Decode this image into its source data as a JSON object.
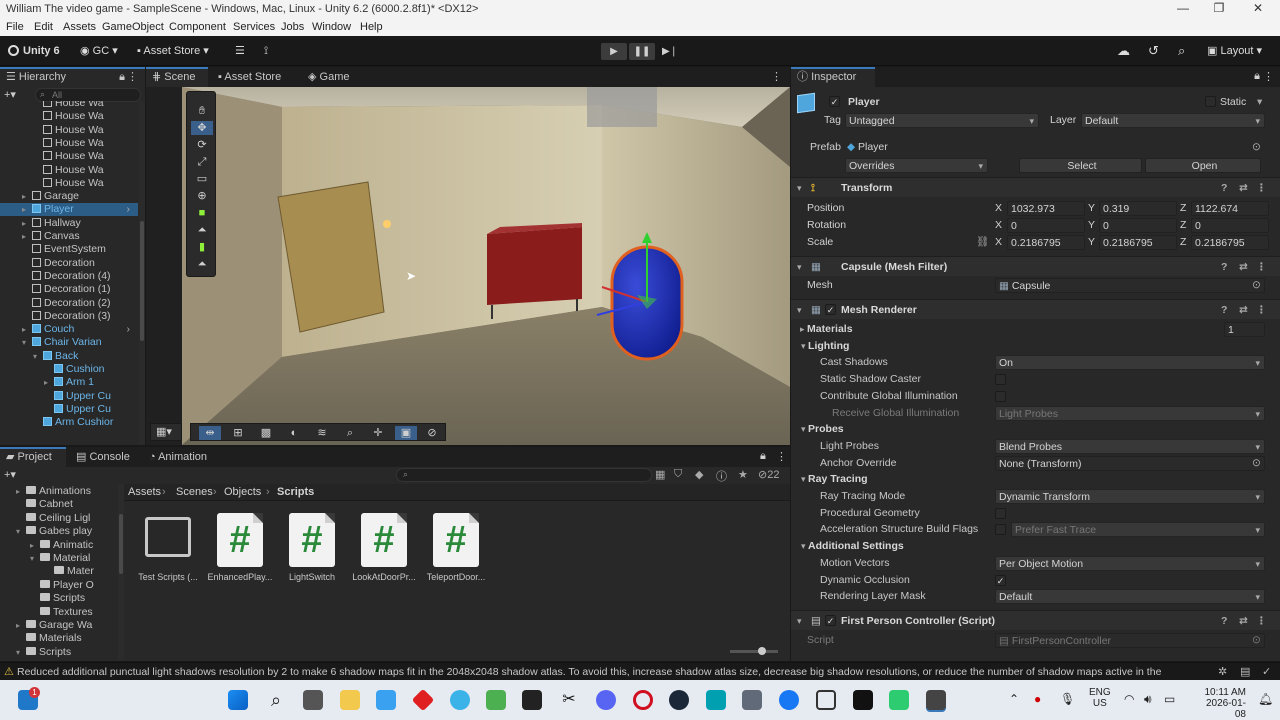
{
  "window": {
    "title": "William The video game - SampleScene - Windows, Mac, Linux - Unity 6.2 (6000.2.8f1)* <DX12>",
    "minimize": "—",
    "maximize": "❐",
    "close": "✕"
  },
  "menu": [
    "File",
    "Edit",
    "Assets",
    "GameObject",
    "Component",
    "Services",
    "Jobs",
    "Window",
    "Help"
  ],
  "toolbar": {
    "unity_label": "Unity 6",
    "gc_label": "GC",
    "asset_store_label": "Asset Store",
    "layout_label": "Layout"
  },
  "hierarchy": {
    "tab_label": "Hierarchy",
    "search_placeholder": "All",
    "items": [
      {
        "label": "House Wa",
        "indent": 3,
        "icon": "white",
        "selected": false,
        "arrow": ""
      },
      {
        "label": "House Wa",
        "indent": 3,
        "icon": "white",
        "selected": false,
        "arrow": ""
      },
      {
        "label": "House Wa",
        "indent": 3,
        "icon": "white",
        "selected": false,
        "arrow": ""
      },
      {
        "label": "House Wa",
        "indent": 3,
        "icon": "white",
        "selected": false,
        "arrow": ""
      },
      {
        "label": "House Wa",
        "indent": 3,
        "icon": "white",
        "selected": false,
        "arrow": ""
      },
      {
        "label": "House Wa",
        "indent": 3,
        "icon": "white",
        "selected": false,
        "arrow": ""
      },
      {
        "label": "House Wa",
        "indent": 3,
        "icon": "white",
        "selected": false,
        "arrow": ""
      },
      {
        "label": "Garage",
        "indent": 2,
        "icon": "white",
        "selected": false,
        "arrow": "▸"
      },
      {
        "label": "Player",
        "indent": 2,
        "icon": "blue",
        "selected": true,
        "arrow": "▸"
      },
      {
        "label": "Hallway",
        "indent": 2,
        "icon": "white",
        "selected": false,
        "arrow": "▸"
      },
      {
        "label": "Canvas",
        "indent": 2,
        "icon": "white",
        "selected": false,
        "arrow": "▸"
      },
      {
        "label": "EventSystem",
        "indent": 2,
        "icon": "white",
        "selected": false,
        "arrow": ""
      },
      {
        "label": "Decoration",
        "indent": 2,
        "icon": "white",
        "selected": false,
        "arrow": ""
      },
      {
        "label": "Decoration (4)",
        "indent": 2,
        "icon": "white",
        "selected": false,
        "arrow": ""
      },
      {
        "label": "Decoration (1)",
        "indent": 2,
        "icon": "white",
        "selected": false,
        "arrow": ""
      },
      {
        "label": "Decoration (2)",
        "indent": 2,
        "icon": "white",
        "selected": false,
        "arrow": ""
      },
      {
        "label": "Decoration (3)",
        "indent": 2,
        "icon": "white",
        "selected": false,
        "arrow": ""
      },
      {
        "label": "Couch",
        "indent": 2,
        "icon": "blue",
        "selected": false,
        "arrow": "▸"
      },
      {
        "label": "Chair Varian",
        "indent": 2,
        "icon": "blue",
        "selected": false,
        "arrow": "▾"
      },
      {
        "label": "Back",
        "indent": 3,
        "icon": "blue",
        "selected": false,
        "arrow": "▾"
      },
      {
        "label": "Cushion",
        "indent": 4,
        "icon": "blue",
        "selected": false,
        "arrow": ""
      },
      {
        "label": "Arm 1",
        "indent": 4,
        "icon": "blue",
        "selected": false,
        "arrow": "▸"
      },
      {
        "label": "Upper Cu",
        "indent": 4,
        "icon": "blue",
        "selected": false,
        "arrow": ""
      },
      {
        "label": "Upper Cu",
        "indent": 4,
        "icon": "blue",
        "selected": false,
        "arrow": ""
      },
      {
        "label": "Arm Cushior",
        "indent": 3,
        "icon": "blue",
        "selected": false,
        "arrow": ""
      }
    ]
  },
  "scene_tabs": [
    "Scene",
    "Asset Store",
    "Game"
  ],
  "inspector": {
    "tab_label": "Inspector",
    "object_name": "Player",
    "static_label": "Static",
    "tag_label": "Tag",
    "tag_value": "Untagged",
    "layer_label": "Layer",
    "layer_value": "Default",
    "prefab_label": "Prefab",
    "prefab_value": "Player",
    "overrides_label": "Overrides",
    "select_label": "Select",
    "open_label": "Open",
    "transform": {
      "header": "Transform",
      "position_label": "Position",
      "rotation_label": "Rotation",
      "scale_label": "Scale",
      "position": {
        "x": "1032.973",
        "y": "0.319",
        "z": "1122.674"
      },
      "rotation": {
        "x": "0",
        "y": "0",
        "z": "0"
      },
      "scale": {
        "x": "0.2186795",
        "y": "0.2186795",
        "z": "0.2186795"
      }
    },
    "mesh_filter": {
      "header": "Capsule (Mesh Filter)",
      "mesh_label": "Mesh",
      "mesh_value": "Capsule"
    },
    "mesh_renderer": {
      "header": "Mesh Renderer",
      "materials_label": "Materials",
      "materials_count": "1",
      "lighting_label": "Lighting",
      "cast_shadows_label": "Cast Shadows",
      "cast_shadows_value": "On",
      "static_shadow_caster_label": "Static Shadow Caster",
      "contribute_gi_label": "Contribute Global Illumination",
      "receive_gi_label": "Receive Global Illumination",
      "receive_gi_value": "Light Probes",
      "probes_label": "Probes",
      "light_probes_label": "Light Probes",
      "light_probes_value": "Blend Probes",
      "anchor_override_label": "Anchor Override",
      "anchor_override_value": "None (Transform)",
      "ray_tracing_label": "Ray Tracing",
      "ray_tracing_mode_label": "Ray Tracing Mode",
      "ray_tracing_mode_value": "Dynamic Transform",
      "procedural_geometry_label": "Procedural Geometry",
      "accel_flags_label": "Acceleration Structure Build Flags",
      "accel_flags_value": "Prefer Fast Trace",
      "additional_settings_label": "Additional Settings",
      "motion_vectors_label": "Motion Vectors",
      "motion_vectors_value": "Per Object Motion",
      "dynamic_occlusion_label": "Dynamic Occlusion",
      "rendering_layer_mask_label": "Rendering Layer Mask",
      "rendering_layer_mask_value": "Default"
    },
    "script_component": {
      "header": "First Person Controller (Script)",
      "script_label": "Script",
      "script_value": "FirstPersonController"
    }
  },
  "project": {
    "tabs": [
      "Project",
      "Console",
      "Animation"
    ],
    "hidden_count": "22",
    "breadcrumb": [
      "Assets",
      "Scenes",
      "Objects",
      "Scripts"
    ],
    "tree": [
      {
        "label": "Animations",
        "indent": 1,
        "arrow": "▸"
      },
      {
        "label": "Cabnet",
        "indent": 1,
        "arrow": ""
      },
      {
        "label": "Ceiling Ligl",
        "indent": 1,
        "arrow": ""
      },
      {
        "label": "Gabes play",
        "indent": 1,
        "arrow": "▾"
      },
      {
        "label": "Animatic",
        "indent": 2,
        "arrow": "▸"
      },
      {
        "label": "Material",
        "indent": 2,
        "arrow": "▾"
      },
      {
        "label": "Mater",
        "indent": 3,
        "arrow": ""
      },
      {
        "label": "Player O",
        "indent": 2,
        "arrow": ""
      },
      {
        "label": "Scripts",
        "indent": 2,
        "arrow": ""
      },
      {
        "label": "Textures",
        "indent": 2,
        "arrow": ""
      },
      {
        "label": "Garage Wa",
        "indent": 1,
        "arrow": "▸"
      },
      {
        "label": "Materials",
        "indent": 1,
        "arrow": ""
      },
      {
        "label": "Scripts",
        "indent": 1,
        "arrow": "▾"
      }
    ],
    "assets": [
      {
        "label": "Test Scripts (...",
        "type": "folder"
      },
      {
        "label": "EnhancedPlay...",
        "type": "script"
      },
      {
        "label": "LightSwitch",
        "type": "script"
      },
      {
        "label": "LookAtDoorPr...",
        "type": "script"
      },
      {
        "label": "TeleportDoor...",
        "type": "script"
      }
    ]
  },
  "status": {
    "message": "Reduced additional punctual light shadows resolution by 2 to make 6 shadow maps fit in the 2048x2048 shadow atlas. To avoid this, increase shadow atlas size, decrease big shadow resolutions, or reduce the number of shadow maps active in the"
  },
  "taskbar": {
    "lang": "ENG",
    "region": "US",
    "time": "10:11 AM",
    "date": "2026-01-08",
    "badge": "1"
  },
  "colors": {
    "accent": "#3a79bb",
    "selection": "#2c5d87",
    "prefab_blue": "#4ea6dc"
  }
}
